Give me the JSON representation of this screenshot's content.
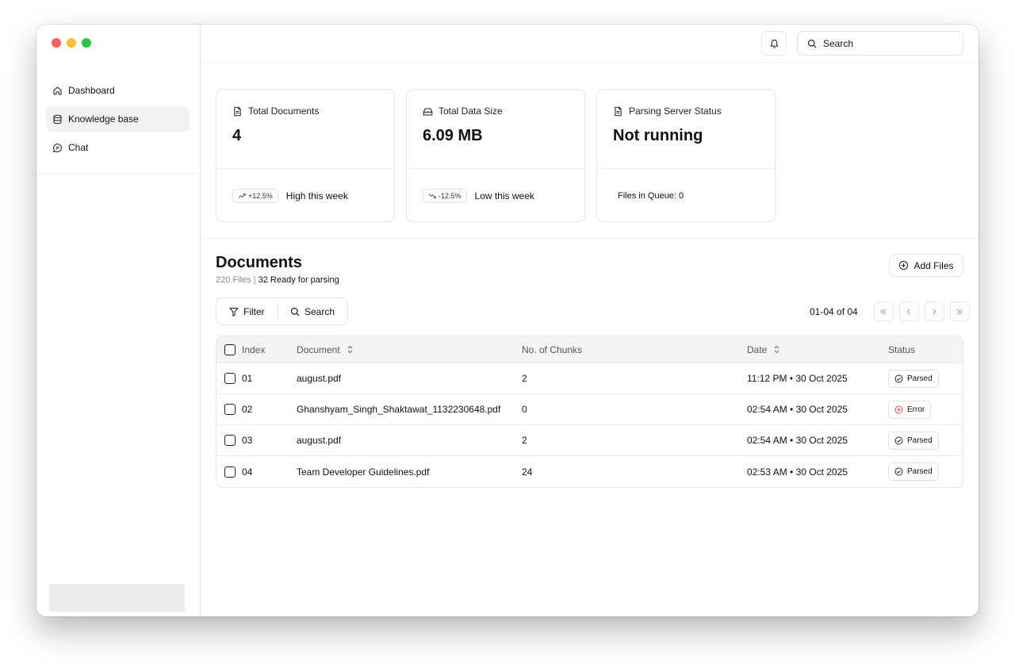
{
  "colors": {
    "traffic_red": "#ff5f57",
    "traffic_yellow": "#febc2e",
    "traffic_green": "#28c840",
    "error_red": "#e5484d"
  },
  "sidebar": {
    "items": [
      {
        "label": "Dashboard",
        "icon": "home-icon",
        "active": false
      },
      {
        "label": "Knowledge base",
        "icon": "database-icon",
        "active": true
      },
      {
        "label": "Chat",
        "icon": "chat-icon",
        "active": false
      }
    ]
  },
  "topbar": {
    "search_placeholder": "Search"
  },
  "stats": {
    "total_documents": {
      "title": "Total Documents",
      "value": "4",
      "trend": "+12.5%",
      "trend_label": "High this week"
    },
    "total_size": {
      "title": "Total Data Size",
      "value": "6.09 MB",
      "trend": "-12.5%",
      "trend_label": "Low this week"
    },
    "server_status": {
      "title": "Parsing Server Status",
      "value": "Not running",
      "queue": "Files in Queue: 0"
    }
  },
  "documents": {
    "title": "Documents",
    "files_count": "220 Files",
    "separator": "|",
    "ready": "32 Ready for parsing",
    "add_files": "Add Files",
    "filter": "Filter",
    "search": "Search",
    "pager": "01-04 of 04",
    "columns": {
      "index": "Index",
      "document": "Document",
      "chunks": "No. of Chunks",
      "date": "Date",
      "status": "Status"
    },
    "rows": [
      {
        "index": "01",
        "document": "august.pdf",
        "chunks": "2",
        "date": "11:12 PM • 30 Oct 2025",
        "status": "Parsed"
      },
      {
        "index": "02",
        "document": "Ghanshyam_Singh_Shaktawat_1132230648.pdf",
        "chunks": "0",
        "date": "02:54 AM • 30 Oct 2025",
        "status": "Error"
      },
      {
        "index": "03",
        "document": "august.pdf",
        "chunks": "2",
        "date": "02:54 AM • 30 Oct 2025",
        "status": "Parsed"
      },
      {
        "index": "04",
        "document": "Team Developer Guidelines.pdf",
        "chunks": "24",
        "date": "02:53 AM • 30 Oct 2025",
        "status": "Parsed"
      }
    ]
  }
}
